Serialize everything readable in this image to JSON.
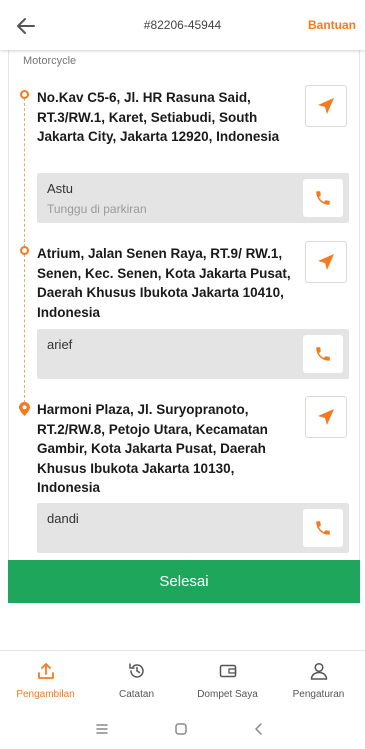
{
  "header": {
    "order_id": "#82206-45944",
    "help_label": "Bantuan"
  },
  "service_type": "Motorcycle",
  "stops": [
    {
      "address": "No.Kav C5-6, Jl. HR Rasuna Said, RT.3/RW.1, Karet, Setiabudi, South Jakarta City, Jakarta 12920, Indonesia",
      "contact_name": "Astu",
      "note": "Tunggu di parkiran"
    },
    {
      "address": "Atrium, Jalan Senen Raya, RT.9/ RW.1, Senen, Kec. Senen, Kota Jakarta Pusat, Daerah Khusus Ibukota Jakarta 10410, Indonesia",
      "contact_name": "arief",
      "note": ""
    },
    {
      "address": "Harmoni Plaza, Jl. Suryopranoto, RT.2/RW.8, Petojo Utara, Kecamatan Gambir, Kota Jakarta Pusat, Daerah Khusus Ibukota Jakarta 10130, Indonesia",
      "contact_name": "dandi",
      "note": ""
    }
  ],
  "done_label": "Selesai",
  "bottom_nav": [
    {
      "label": "Pengambilan",
      "icon": "upload-icon",
      "active": true
    },
    {
      "label": "Catatan",
      "icon": "history-icon",
      "active": false
    },
    {
      "label": "Dompet Saya",
      "icon": "wallet-icon",
      "active": false
    },
    {
      "label": "Pengaturan",
      "icon": "user-icon",
      "active": false
    }
  ],
  "colors": {
    "accent": "#f47a20",
    "primary_button": "#1ea65c",
    "contact_box": "#e4e4e4"
  }
}
